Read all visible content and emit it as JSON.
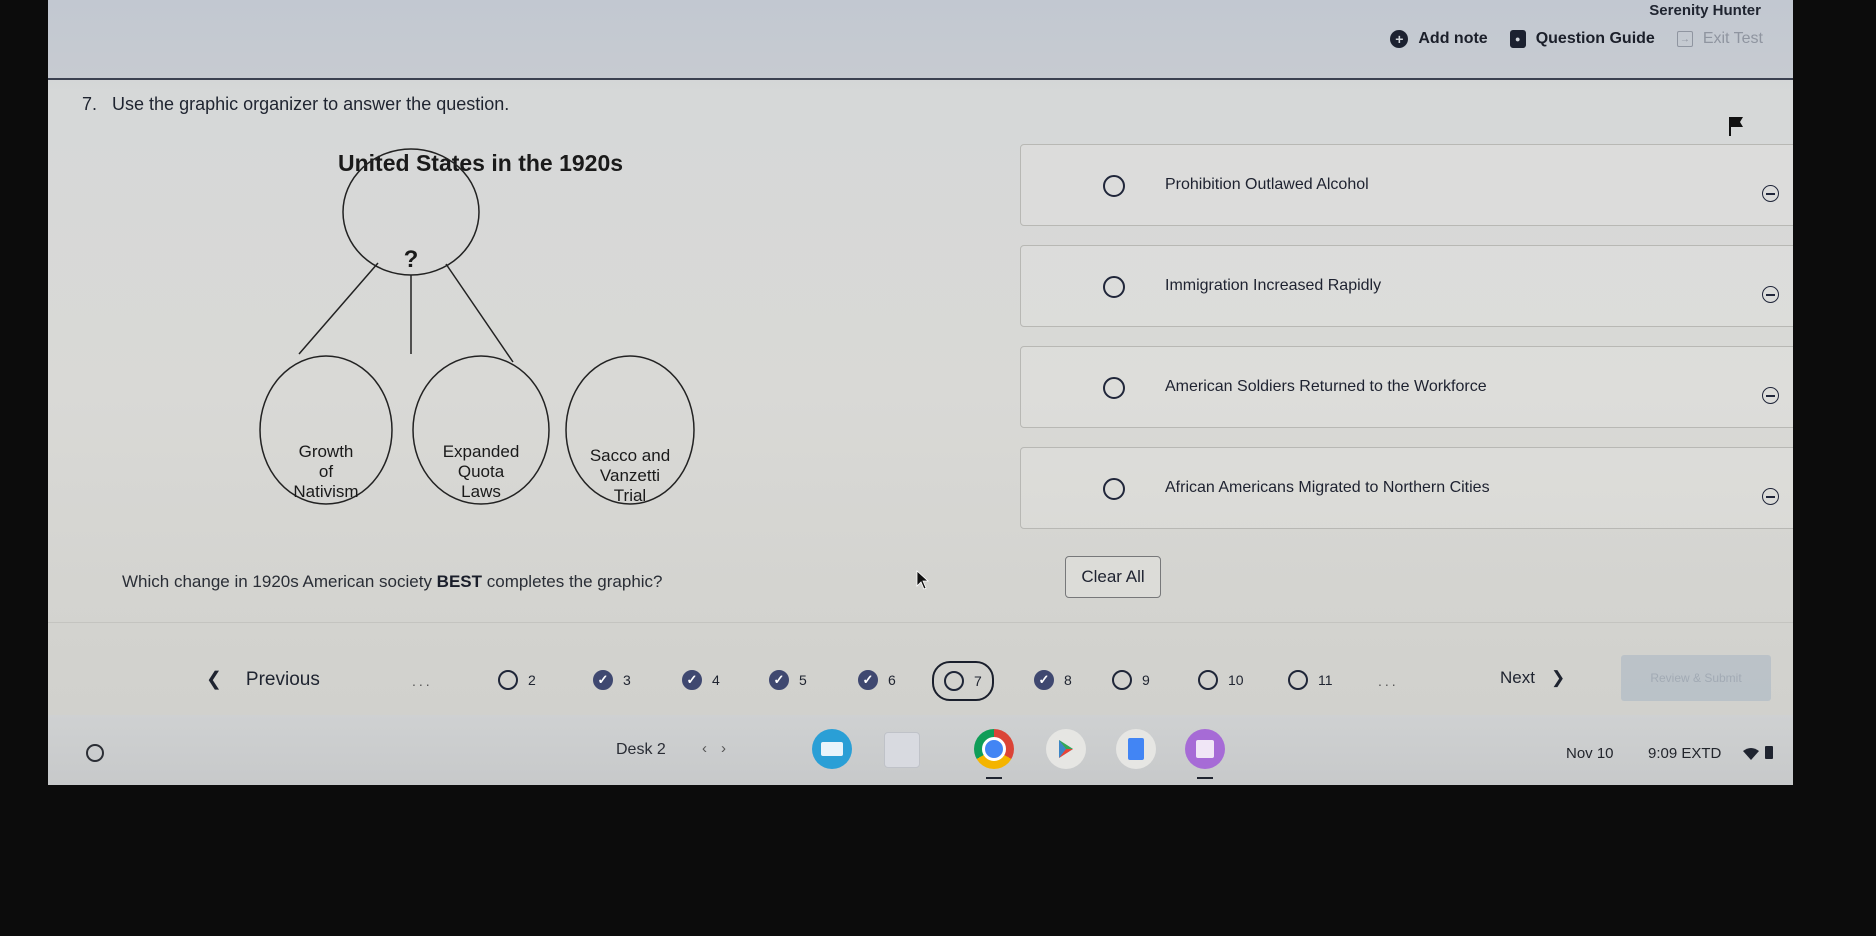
{
  "header": {
    "user_name": "Serenity Hunter",
    "actions": [
      {
        "label": "Add note",
        "icon": "add-note-icon"
      },
      {
        "label": "Question Guide",
        "icon": "question-guide-icon"
      },
      {
        "label": "Exit Test",
        "icon": "exit-icon"
      }
    ]
  },
  "question": {
    "number": "7.",
    "prompt": "Use the graphic organizer to answer the question.",
    "stem_before": "Which change in 1920s American society ",
    "stem_bold": "BEST",
    "stem_after": " completes the graphic?",
    "flagged_icon": "flag-icon"
  },
  "organizer": {
    "title": "United States in the 1920s",
    "center": "?",
    "nodes": [
      {
        "lines": [
          "Growth",
          "of",
          "Nativism"
        ]
      },
      {
        "lines": [
          "Expanded",
          "Quota",
          "Laws"
        ]
      },
      {
        "lines": [
          "Sacco and",
          "Vanzetti",
          "Trial"
        ]
      }
    ]
  },
  "options": [
    {
      "label": "Prohibition Outlawed Alcohol",
      "selected": false
    },
    {
      "label": "Immigration Increased Rapidly",
      "selected": false
    },
    {
      "label": "American Soldiers Returned to the Workforce",
      "selected": false
    },
    {
      "label": "African Americans Migrated to Northern Cities",
      "selected": false
    }
  ],
  "clear_all_label": "Clear All",
  "navigation": {
    "previous_label": "Previous",
    "next_label": "Next",
    "review_label": "Review & Submit",
    "ellipsis": "...",
    "questions": [
      {
        "number": "2",
        "answered": false,
        "current": false
      },
      {
        "number": "3",
        "answered": true,
        "current": false
      },
      {
        "number": "4",
        "answered": true,
        "current": false
      },
      {
        "number": "5",
        "answered": true,
        "current": false
      },
      {
        "number": "6",
        "answered": true,
        "current": false
      },
      {
        "number": "7",
        "answered": false,
        "current": true
      },
      {
        "number": "8",
        "answered": true,
        "current": false
      },
      {
        "number": "9",
        "answered": false,
        "current": false
      },
      {
        "number": "10",
        "answered": false,
        "current": false
      },
      {
        "number": "11",
        "answered": false,
        "current": false
      }
    ]
  },
  "shelf": {
    "desk_label": "Desk 2",
    "apps": [
      "classroom-app-icon",
      "blank-window-icon",
      "chrome-icon",
      "play-store-icon",
      "docs-icon",
      "purple-app-icon"
    ],
    "date": "Nov 10",
    "time": "9:09 EXTD"
  },
  "colors": {
    "answered": "#3f4870",
    "text": "#1f2430"
  }
}
